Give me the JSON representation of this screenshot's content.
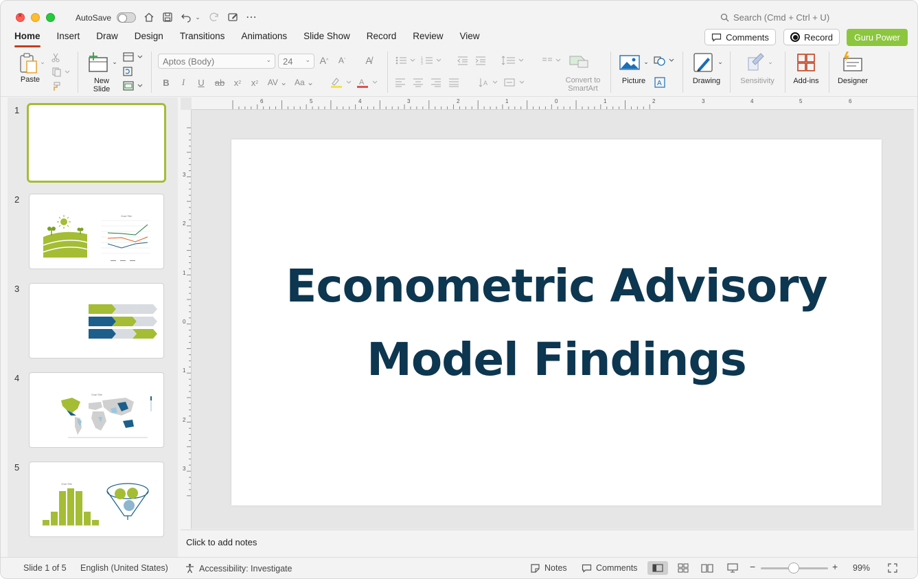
{
  "titlebar": {
    "autosave_label": "AutoSave",
    "search_placeholder": "Search (Cmd + Ctrl + U)"
  },
  "menu": {
    "tabs": [
      "Home",
      "Insert",
      "Draw",
      "Design",
      "Transitions",
      "Animations",
      "Slide Show",
      "Record",
      "Review",
      "View"
    ],
    "active_tab": "Home",
    "comments_label": "Comments",
    "record_label": "Record",
    "guru_label": "Guru Power"
  },
  "ribbon": {
    "paste": "Paste",
    "new_slide_1": "New",
    "new_slide_2": "Slide",
    "font_name": "Aptos (Body)",
    "font_size": "24",
    "convert_1": "Convert to",
    "convert_2": "SmartArt",
    "picture": "Picture",
    "drawing": "Drawing",
    "sensitivity": "Sensitivity",
    "addins": "Add-ins",
    "designer": "Designer"
  },
  "thumbnails": {
    "numbers": [
      "1",
      "2",
      "3",
      "4",
      "5"
    ],
    "chart_title_2": "Chart Title",
    "chart_title_4": "Chart Title",
    "chart_title_5": "Chart Title"
  },
  "slide": {
    "title_line1": "Econometric Advisory",
    "title_line2": "Model Findings"
  },
  "ruler": {
    "h_numbers": [
      "6",
      "5",
      "4",
      "3",
      "2",
      "1",
      "0",
      "1",
      "2",
      "3",
      "4",
      "5",
      "6"
    ],
    "v_numbers": [
      "3",
      "2",
      "1",
      "0",
      "1",
      "2",
      "3"
    ]
  },
  "notes": {
    "placeholder": "Click to add notes"
  },
  "status": {
    "slide_counter": "Slide 1 of 5",
    "language": "English (United States)",
    "accessibility": "Accessibility: Investigate",
    "notes": "Notes",
    "comments": "Comments",
    "zoom": "99%"
  },
  "colors": {
    "accent_green": "#a4bd34",
    "title_navy": "#0d3650",
    "guru_green": "#8cc63f",
    "tab_underline": "#c43e1c"
  }
}
